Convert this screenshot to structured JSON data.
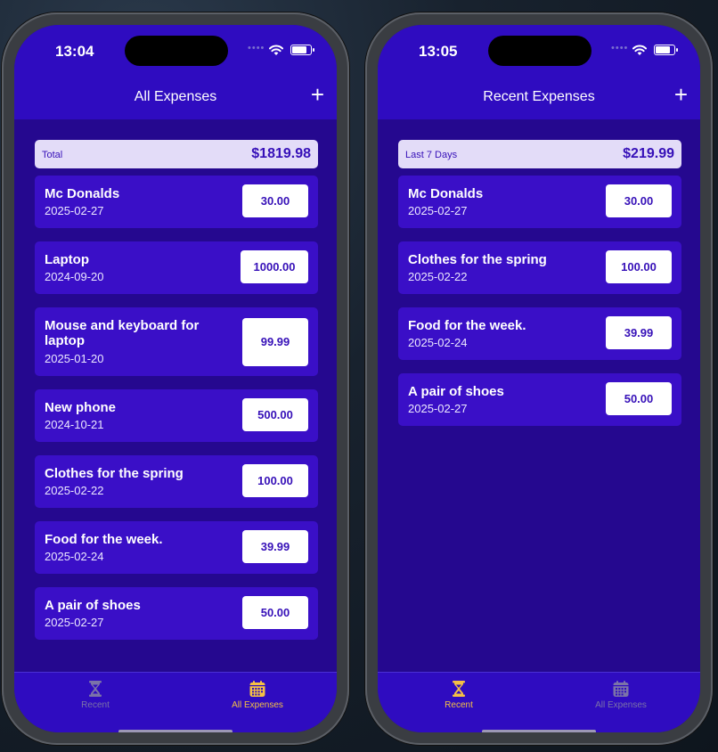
{
  "colors": {
    "accent_active": "#f5c044",
    "tab_inactive": "#7b73a8",
    "card_bg": "#3a0fc7",
    "summary_bg": "#e3dcf8"
  },
  "screens": [
    {
      "time": "13:04",
      "title": "All Expenses",
      "add_icon": "+",
      "summary": {
        "label": "Total",
        "value": "$1819.98"
      },
      "expenses": [
        {
          "name": "Mc Donalds",
          "date": "2025-02-27",
          "amount": "30.00"
        },
        {
          "name": "Laptop",
          "date": "2024-09-20",
          "amount": "1000.00"
        },
        {
          "name": "Mouse and keyboard for laptop",
          "date": "2025-01-20",
          "amount": "99.99"
        },
        {
          "name": "New phone",
          "date": "2024-10-21",
          "amount": "500.00"
        },
        {
          "name": "Clothes for the spring",
          "date": "2025-02-22",
          "amount": "100.00"
        },
        {
          "name": "Food for the week.",
          "date": "2025-02-24",
          "amount": "39.99"
        },
        {
          "name": "A pair of shoes",
          "date": "2025-02-27",
          "amount": "50.00"
        }
      ],
      "tabs": [
        {
          "label": "Recent",
          "icon": "hourglass-icon",
          "active": false
        },
        {
          "label": "All Expenses",
          "icon": "calendar-icon",
          "active": true
        }
      ]
    },
    {
      "time": "13:05",
      "title": "Recent Expenses",
      "add_icon": "+",
      "summary": {
        "label": "Last 7 Days",
        "value": "$219.99"
      },
      "expenses": [
        {
          "name": "Mc Donalds",
          "date": "2025-02-27",
          "amount": "30.00"
        },
        {
          "name": "Clothes for the spring",
          "date": "2025-02-22",
          "amount": "100.00"
        },
        {
          "name": "Food for the week.",
          "date": "2025-02-24",
          "amount": "39.99"
        },
        {
          "name": "A pair of shoes",
          "date": "2025-02-27",
          "amount": "50.00"
        }
      ],
      "tabs": [
        {
          "label": "Recent",
          "icon": "hourglass-icon",
          "active": true
        },
        {
          "label": "All Expenses",
          "icon": "calendar-icon",
          "active": false
        }
      ]
    }
  ]
}
